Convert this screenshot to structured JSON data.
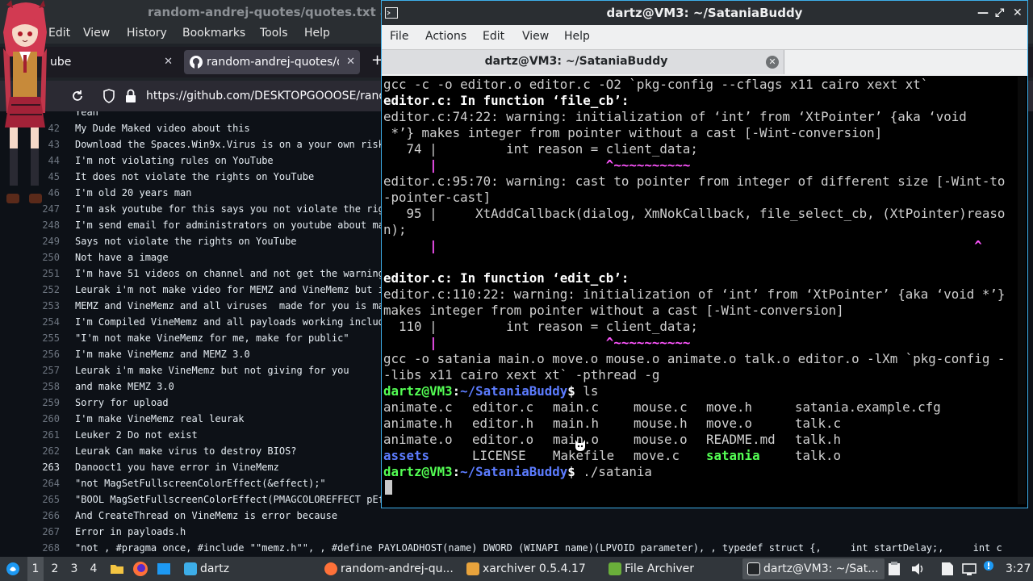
{
  "firefox": {
    "title": "random-andrej-quotes/quotes.txt a",
    "menu": [
      "Edit",
      "View",
      "History",
      "Bookmarks",
      "Tools",
      "Help"
    ],
    "tabs": [
      {
        "label": "ube",
        "close": "✕"
      },
      {
        "label": "random-andrej-quotes/qu",
        "close": "✕"
      }
    ],
    "new_tab": "+",
    "url": "https://github.com/DESKTOPGOOOSE/rand",
    "code_lines": [
      {
        "num": "",
        "text": "Yeah"
      },
      {
        "num": "42",
        "text": "My Dude Maked video about this"
      },
      {
        "num": "43",
        "text": "Download the Spaces.Win9x.Virus is on a your own risk"
      },
      {
        "num": "44",
        "text": "I'm not violating rules on YouTube"
      },
      {
        "num": "45",
        "text": "It does not violate the rights on YouTube"
      },
      {
        "num": "46",
        "text": "I'm old 20 years man"
      },
      {
        "num": "247",
        "text": "I'm ask youtube for this says you not violate the rig"
      },
      {
        "num": "248",
        "text": "I'm send email for administrators on youtube about ma"
      },
      {
        "num": "249",
        "text": "Says not violate the rights on YouTube"
      },
      {
        "num": "250",
        "text": "Not have a image"
      },
      {
        "num": "251",
        "text": "I'm have 51 videos on channel and not get the warning"
      },
      {
        "num": "252",
        "text": "Leurak i'm not make video for MEMZ and VineMemz but i"
      },
      {
        "num": "253",
        "text": "MEMZ and VineMemz and all viruses  made for you is ma"
      },
      {
        "num": "254",
        "text": "I'm Compiled VineMemz and all payloads working includ"
      },
      {
        "num": "255",
        "text": "\"I'm not make VineMemz for me, make for public\""
      },
      {
        "num": "256",
        "text": "I'm make VineMemz and MEMZ 3.0"
      },
      {
        "num": "257",
        "text": "Leurak i'm make VineMemz but not giving for you"
      },
      {
        "num": "258",
        "text": "and make MEMZ 3.0"
      },
      {
        "num": "259",
        "text": "Sorry for upload"
      },
      {
        "num": "260",
        "text": "I'm make VineMemz real leurak"
      },
      {
        "num": "261",
        "text": "Leuker 2 Do not exist"
      },
      {
        "num": "262",
        "text": "Leurak Can make virus to destroy BIOS?"
      },
      {
        "num": "263",
        "text": "Danooct1 you have error in VineMemz"
      },
      {
        "num": "264",
        "text": "\"not MagSetFullscreenColorEffect(&effect);\""
      },
      {
        "num": "265",
        "text": "\"BOOL MagSetFullscreenColorEffect(PMAGCOLOREFFECT pEf"
      },
      {
        "num": "266",
        "text": "And CreateThread on VineMemz is error because"
      },
      {
        "num": "267",
        "text": "Error in payloads.h"
      },
      {
        "num": "268",
        "text": "\"not , #pragma once, #include \"\"memz.h\"\", , #define PAYLOADHOST(name) DWORD (WINAPI name)(LPVOID parameter), , typedef struct {,     int startDelay;,     int c"
      }
    ]
  },
  "terminal": {
    "title": "dartz@VM3: ~/SataniaBuddy",
    "tab_label": "dartz@VM3: ~/SataniaBuddy",
    "menu": [
      "File",
      "Actions",
      "Edit",
      "View",
      "Help"
    ],
    "lines": [
      "gcc -c -o editor.o editor.c -O2 `pkg-config --cflags x11 cairo xext xt`",
      "editor.c: In function ‘file_cb’:",
      "editor.c:74:22: warning: initialization of ‘int’ from ‘XtPointer’ {aka ‘void",
      " *’} makes integer from pointer without a cast [-Wint-conversion]",
      "   74 |         int reason = client_data;",
      "      |                      ^~~~~~~~~~~",
      "editor.c:95:70: warning: cast to pointer from integer of different size [-Wint-to-pointer-cast]",
      "   95 |     XtAddCallback(dialog, XmNokCallback, file_select_cb, (XtPointer)reason);",
      "      |                                                                      ^",
      "editor.c: In function ‘edit_cb’:",
      "editor.c:110:22: warning: initialization of ‘int’ from ‘XtPointer’ {aka ‘void *’} makes integer from pointer without a cast [-Wint-conversion]",
      "  110 |         int reason = client_data;",
      "      |                      ^~~~~~~~~~~",
      "gcc -o satania main.o move.o mouse.o animate.o talk.o editor.o -lXm `pkg-config --libs x11 cairo xext xt` -pthread -g"
    ],
    "prompt_user": "dartz@VM3",
    "prompt_sep": ":",
    "prompt_path": "~/SataniaBuddy",
    "prompt_end": "$",
    "cmd1": " ls",
    "cmd2": " ./satania",
    "files": [
      [
        "animate.c",
        "editor.c",
        "main.c",
        "mouse.c",
        "move.h",
        "satania.example.cfg"
      ],
      [
        "animate.h",
        "editor.h",
        "main.h",
        "mouse.h",
        "move.o",
        "talk.c"
      ],
      [
        "animate.o",
        "editor.o",
        "main.o",
        "mouse.o",
        "README.md",
        "talk.h"
      ],
      [
        "assets",
        "LICENSE",
        "Makefile",
        "move.c",
        "satania",
        "talk.o"
      ]
    ]
  },
  "taskbar": {
    "desktops": [
      "1",
      "2",
      "3",
      "4"
    ],
    "folder_label": "dartz",
    "tasks": [
      {
        "label": "random-andrej-qu..."
      },
      {
        "label": "xarchiver 0.5.4.17"
      },
      {
        "label": "File Archiver"
      },
      {
        "label": "dartz@VM3: ~/Sat..."
      }
    ],
    "clock": "3:27"
  },
  "colors": {
    "accent": "#3daee9",
    "warning": "#ff55ff",
    "prompt": "#54ff54",
    "directory": "#5c7cff"
  }
}
